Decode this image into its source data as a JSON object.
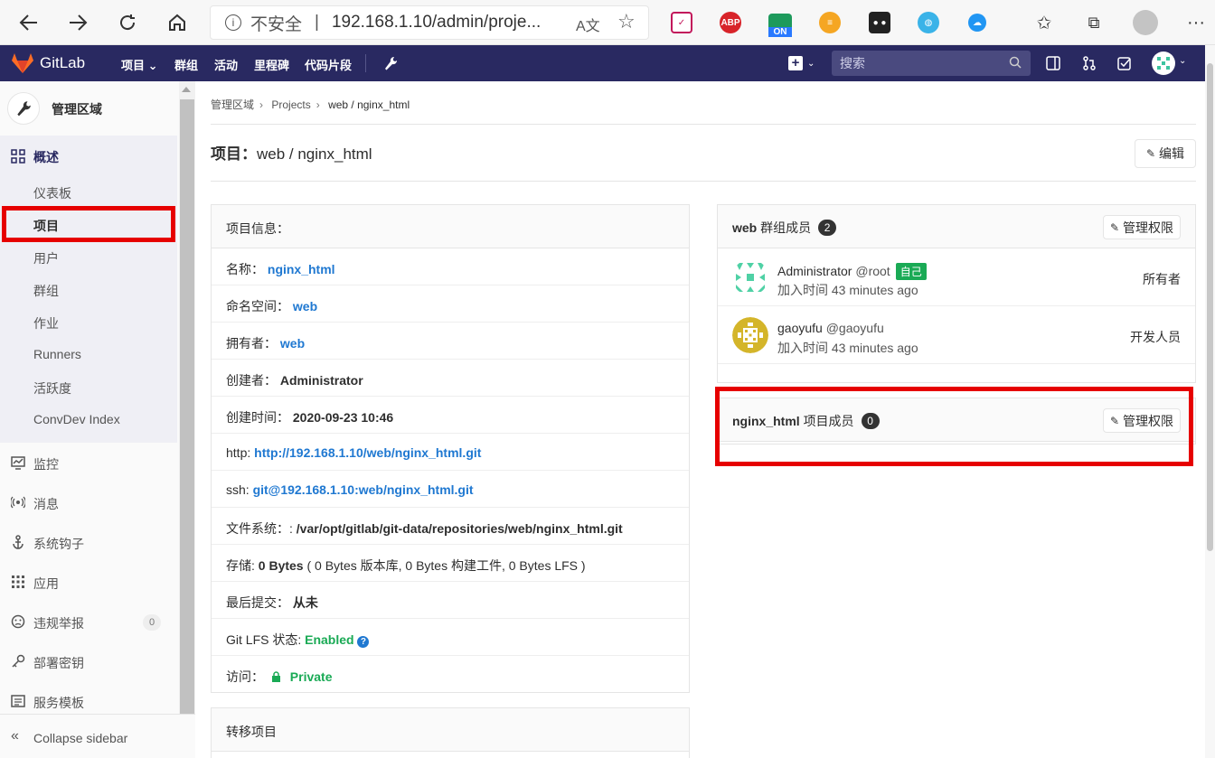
{
  "browser": {
    "insecure_label": "不安全",
    "url": "192.168.1.10/admin/proje...",
    "back_icon": "back-arrow-icon",
    "forward_icon": "forward-arrow-icon",
    "reload_icon": "reload-icon",
    "home_icon": "home-icon",
    "extension_labels": {
      "abp": "ABP",
      "on": "ON"
    }
  },
  "navbar": {
    "brand": "GitLab",
    "items": [
      "项目",
      "群组",
      "活动",
      "里程碑",
      "代码片段"
    ],
    "search_placeholder": "搜索",
    "brand_color": "#292961"
  },
  "sidebar": {
    "title": "管理区域",
    "overview": "概述",
    "subitems": [
      "仪表板",
      "项目",
      "用户",
      "群组",
      "作业",
      "Runners",
      "活跃度",
      "ConvDev Index"
    ],
    "items": [
      "监控",
      "消息",
      "系统钩子",
      "应用",
      "违规举报",
      "部署密钥",
      "服务模板"
    ],
    "abuse_count": "0",
    "collapse": "Collapse sidebar"
  },
  "breadcrumb": [
    "管理区域",
    "Projects",
    "web / nginx_html"
  ],
  "page": {
    "title_prefix": "项目：",
    "title": "web / nginx_html",
    "edit_label": "编辑"
  },
  "info_panel": {
    "header": "项目信息：",
    "name_label": "名称：",
    "name_value": "nginx_html",
    "namespace_label": "命名空间：",
    "namespace_value": "web",
    "owner_label": "拥有者：",
    "owner_value": "web",
    "creator_label": "创建者：",
    "creator_value": "Administrator",
    "created_label": "创建时间：",
    "created_value": "2020-09-23 10:46",
    "http_label": "http:",
    "http_value": "http://192.168.1.10/web/nginx_html.git",
    "ssh_label": "ssh:",
    "ssh_value": "git@192.168.1.10:web/nginx_html.git",
    "fs_label": "文件系统：:",
    "fs_value": "/var/opt/gitlab/git-data/repositories/web/nginx_html.git",
    "storage_label": "存储:",
    "storage_value": "0 Bytes",
    "storage_detail": "( 0 Bytes 版本库, 0 Bytes 构建工件, 0 Bytes LFS )",
    "last_commit_label": "最后提交：",
    "last_commit_value": "从未",
    "lfs_label": "Git LFS 状态:",
    "lfs_value": "Enabled",
    "access_label": "访问：",
    "access_value": "Private"
  },
  "transfer_panel": {
    "header": "转移项目"
  },
  "group_members": {
    "group": "web",
    "header_suffix": "群组成员",
    "count": "2",
    "manage_label": "管理权限",
    "members": [
      {
        "name": "Administrator",
        "handle": "@root",
        "badge": "自己",
        "since": "加入时间 43 minutes ago",
        "role": "所有者"
      },
      {
        "name": "gaoyufu",
        "handle": "@gaoyufu",
        "since": "加入时间 43 minutes ago",
        "role": "开发人员"
      }
    ]
  },
  "project_members": {
    "project": "nginx_html",
    "header_suffix": "项目成员",
    "count": "0",
    "manage_label": "管理权限"
  },
  "colors": {
    "link": "#1f78d1",
    "success": "#1aaa55",
    "highlight": "#e60000"
  }
}
